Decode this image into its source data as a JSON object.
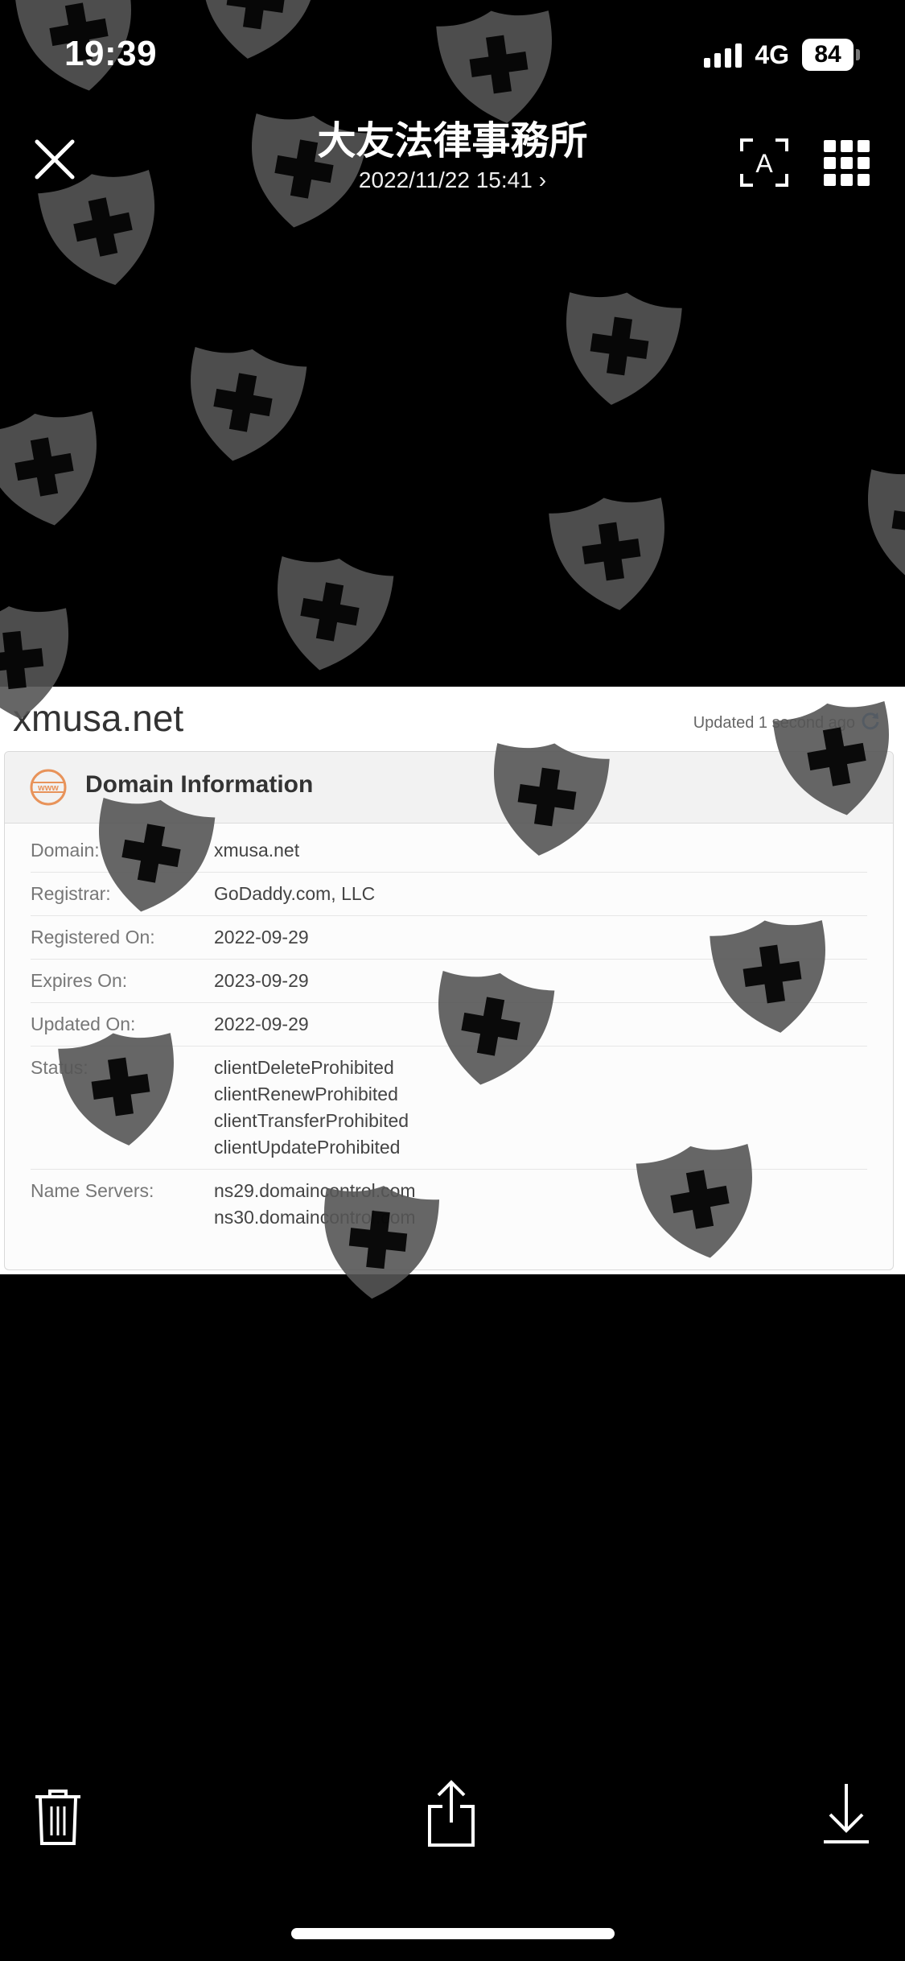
{
  "status_bar": {
    "time": "19:39",
    "network": "4G",
    "battery": "84"
  },
  "header": {
    "title": "大友法律事務所",
    "subtitle": "2022/11/22 15:41",
    "chevron": "›"
  },
  "icons": {
    "close": "close-icon",
    "ocr": "live-text-icon",
    "grid": "grid-icon",
    "trash": "trash-icon",
    "share": "share-icon",
    "download": "download-icon",
    "refresh": "refresh-icon",
    "www": "www-icon",
    "watermark": "shield-cross-icon"
  },
  "document": {
    "domain_title": "xmusa.net",
    "updated_text": "Updated 1 second ago",
    "panel_title": "Domain Information",
    "rows": [
      {
        "label": "Domain:",
        "values": [
          "xmusa.net"
        ]
      },
      {
        "label": "Registrar:",
        "values": [
          "GoDaddy.com, LLC"
        ]
      },
      {
        "label": "Registered On:",
        "values": [
          "2022-09-29"
        ]
      },
      {
        "label": "Expires On:",
        "values": [
          "2023-09-29"
        ]
      },
      {
        "label": "Updated On:",
        "values": [
          "2022-09-29"
        ]
      },
      {
        "label": "Status:",
        "values": [
          "clientDeleteProhibited",
          "clientRenewProhibited",
          "clientTransferProhibited",
          "clientUpdateProhibited"
        ]
      },
      {
        "label": "Name Servers:",
        "values": [
          "ns29.domaincontrol.com",
          "ns30.domaincontrol.com"
        ]
      }
    ]
  },
  "colors": {
    "background": "#000000",
    "watermark": "#555555",
    "accent": "#4a90d9",
    "www_icon": "#e8935a"
  }
}
